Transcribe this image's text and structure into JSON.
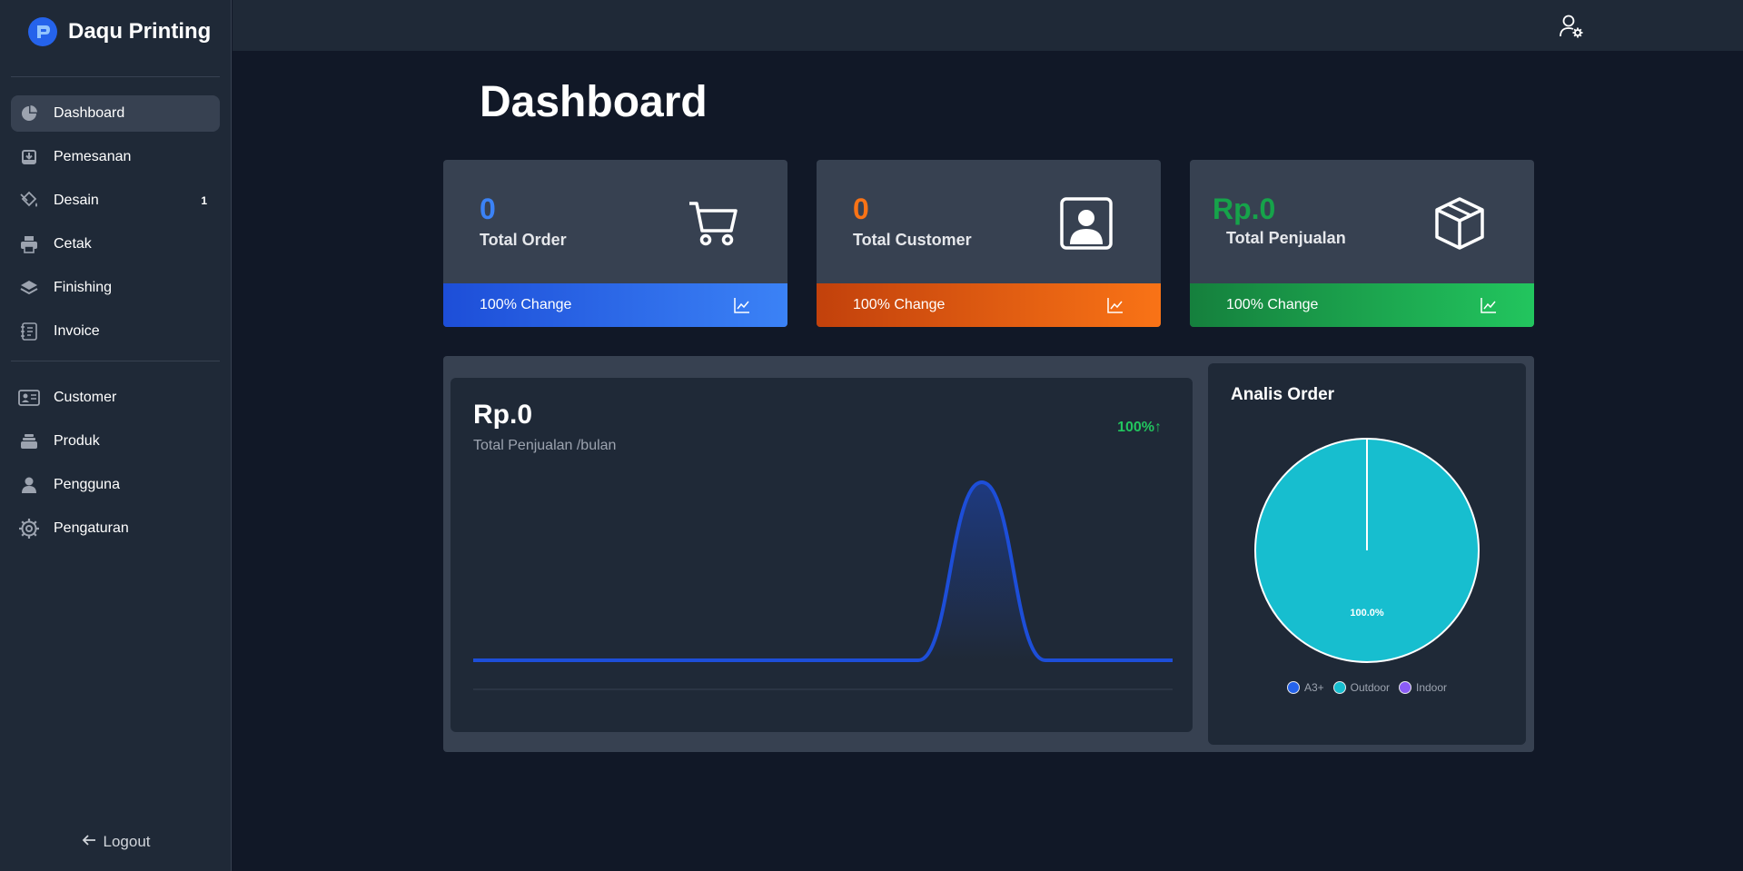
{
  "brand": {
    "name": "Daqu Printing"
  },
  "sidebar": {
    "primary": [
      {
        "label": "Dashboard",
        "icon": "chart-pie-icon",
        "active": true
      },
      {
        "label": "Pemesanan",
        "icon": "inbox-download-icon"
      },
      {
        "label": "Desain",
        "icon": "paint-bucket-icon",
        "badge": "1"
      },
      {
        "label": "Cetak",
        "icon": "printer-icon"
      },
      {
        "label": "Finishing",
        "icon": "layers-icon"
      },
      {
        "label": "Invoice",
        "icon": "notebook-icon"
      }
    ],
    "secondary": [
      {
        "label": "Customer",
        "icon": "id-card-icon"
      },
      {
        "label": "Produk",
        "icon": "stack-icon"
      },
      {
        "label": "Pengguna",
        "icon": "user-icon"
      },
      {
        "label": "Pengaturan",
        "icon": "gear-icon"
      }
    ],
    "logout": "Logout"
  },
  "page": {
    "title": "Dashboard"
  },
  "stats": [
    {
      "value": "0",
      "label": "Total Order",
      "change": "100% Change",
      "value_color": "#3b82f6",
      "gradient": [
        "#1d4ed8",
        "#3b82f6"
      ]
    },
    {
      "value": "0",
      "label": "Total Customer",
      "change": "100% Change",
      "value_color": "#f97316",
      "gradient": [
        "#c2410c",
        "#f97316"
      ]
    },
    {
      "value": "Rp.0",
      "label": "Total Penjualan",
      "change": "100% Change",
      "value_color": "#16a34a",
      "gradient": [
        "#15803d",
        "#22c55e"
      ]
    }
  ],
  "sales": {
    "value": "Rp.0",
    "label": "Total Penjualan /bulan",
    "change": "100%↑"
  },
  "analysis": {
    "title": "Analis Order",
    "slice_label": "100.0%",
    "legend": [
      {
        "label": "A3+",
        "color": "#2563eb"
      },
      {
        "label": "Outdoor",
        "color": "#17becf"
      },
      {
        "label": "Indoor",
        "color": "#8b5cf6"
      }
    ]
  },
  "chart_data": [
    {
      "type": "area",
      "x": [
        1,
        2,
        3,
        4,
        5,
        6,
        7,
        8,
        9,
        10,
        11,
        12
      ],
      "series": [
        {
          "values": [
            0,
            0,
            0,
            0,
            0,
            0,
            0,
            0,
            1,
            0,
            0,
            0
          ]
        }
      ],
      "color": "#1d4ed8",
      "grid": false
    },
    {
      "type": "pie",
      "categories": [
        "A3+",
        "Outdoor",
        "Indoor"
      ],
      "values": [
        0,
        100,
        0
      ],
      "data_labels": [
        "",
        "100.0%",
        ""
      ],
      "colors": [
        "#2563eb",
        "#17becf",
        "#8b5cf6"
      ]
    }
  ]
}
